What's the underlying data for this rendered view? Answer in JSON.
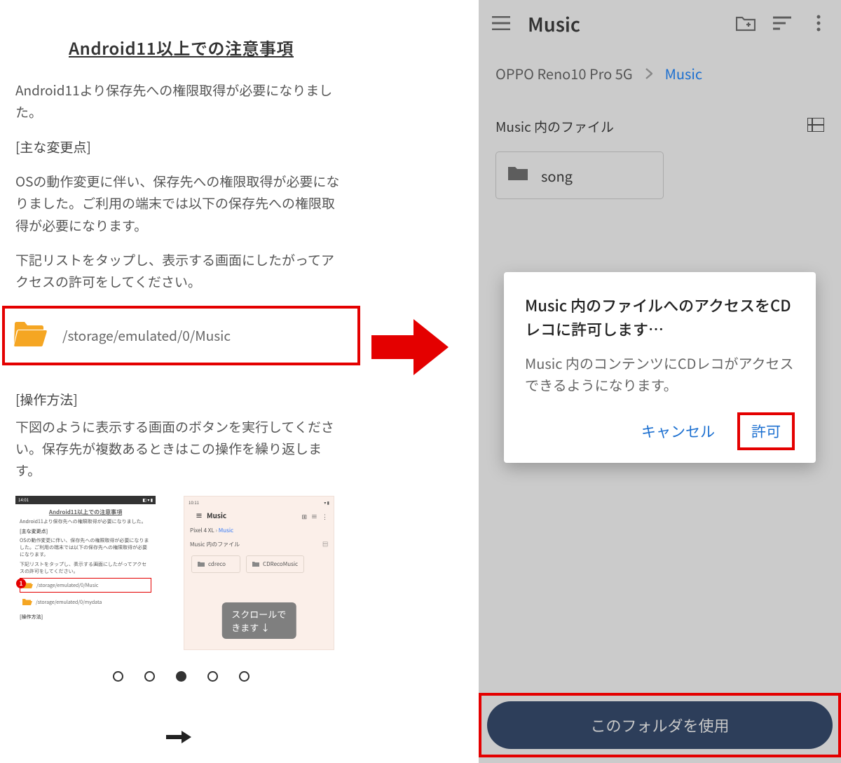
{
  "left": {
    "title": "Android11以上での注意事項",
    "intro": "Android11より保存先への権限取得が必要になりました。",
    "changes_label": "[主な変更点]",
    "changes_body": "OSの動作変更に伴い、保存先への権限取得が必要になりました。ご利用の端末では以下の保存先への権限取得が必要になります。",
    "changes_body2": "下記リストをタップし、表示する画面にしたがってアクセスの許可をしてください。",
    "path": "/storage/emulated/0/Music",
    "howto_label": "[操作方法]",
    "howto_body": "下図のように表示する画面のボタンを実行してください。保存先が複数あるときはこの操作を繰り返します。",
    "thumb1": {
      "time": "14:01",
      "title": "Android11以上での注意事項",
      "p1": "Android11より保存先への権限取得が必要になりました。",
      "label": "[主な変更点]",
      "p2": "OSの動作変更に伴い、保存先への権限取得が必要になりました。ご利用の端末では以下の保存先への権限取得が必要になります。",
      "p3": "下記リストをタップし、表示する画面にしたがってアクセスの許可をしてください。",
      "path1": "/storage/emulated/0/Music",
      "path2": "/storage/emulated/0/mydata",
      "label2": "[操作方法]",
      "badge": "1"
    },
    "thumb2": {
      "time": "10:11",
      "title": "Music",
      "crumb_root": "Pixel 4 XL",
      "crumb_cur": "Music",
      "section": "Music 内のファイル",
      "f1": "cdreco",
      "f2": "CDRecoMusic",
      "scroll": "スクロールできます ↓"
    },
    "dots": {
      "count": 5,
      "active": 2
    }
  },
  "right": {
    "title": "Music",
    "crumb_root": "OPPO Reno10 Pro 5G",
    "crumb_cur": "Music",
    "section": "Music 内のファイル",
    "folder": "song",
    "dialog": {
      "title": "Music 内のファイルへのアクセスをCDレコに許可します…",
      "body": "Music 内のコンテンツにCDレコがアクセスできるようになります。",
      "cancel": "キャンセル",
      "allow": "許可"
    },
    "bottom_button": "このフォルダを使用"
  }
}
